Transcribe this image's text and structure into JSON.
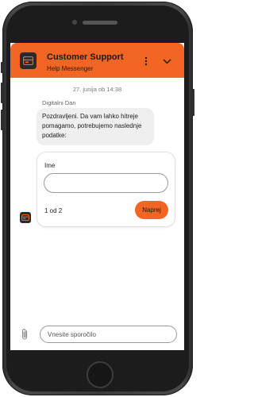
{
  "header": {
    "title": "Customer Support",
    "subtitle": "Help Messenger",
    "menu_icon": "more-vertical-icon",
    "collapse_icon": "chevron-down-icon",
    "logo_icon": "chat-widget-logo-icon"
  },
  "conversation": {
    "timestamp": "27. junija ob 14:38",
    "sender": "Digitalni Dan",
    "message": "Pozdravljeni. Da vam lahko hitreje pomagamo, potrebujemo naslednje podatke:"
  },
  "form": {
    "field_label": "Ime",
    "field_value": "",
    "field_placeholder": "",
    "step": "1 od 2",
    "next_label": "Naprej"
  },
  "composer": {
    "attach_icon": "paperclip-icon",
    "placeholder": "Vnesite sporočilo"
  },
  "colors": {
    "accent": "#f26522",
    "dark": "#2a2a2a",
    "bubble": "#efefef"
  }
}
